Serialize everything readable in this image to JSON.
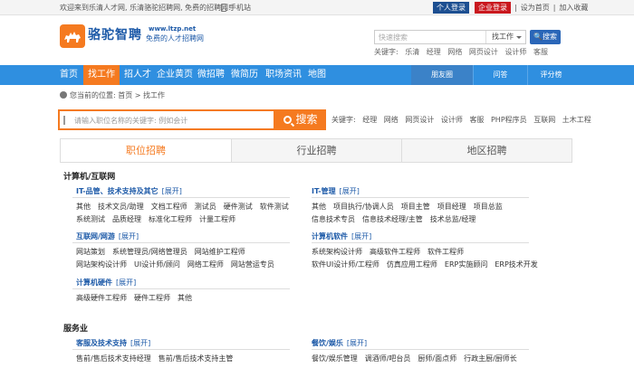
{
  "topbar": {
    "welcome": "欢迎来到乐清人才网, 乐清骆驼招聘网, 免费的招聘网!",
    "mobile": "手机站",
    "personal_login": "个人登录",
    "company_login": "企业登录",
    "set_home": "设为首页",
    "bookmark": "加入收藏"
  },
  "logo": {
    "name": "骆驼智聘",
    "url": "www.ltzp.net",
    "slogan": "免费的人才招聘网"
  },
  "top_search": {
    "placeholder": "快速搜索",
    "type": "找工作",
    "button": "搜索",
    "hot_label": "关键字:",
    "hot": [
      "乐清",
      "经理",
      "网络",
      "网页设计",
      "设计师",
      "客服"
    ]
  },
  "nav": {
    "items": [
      "首页",
      "找工作",
      "招人才",
      "企业黄页",
      "微招聘",
      "微简历",
      "职场资讯",
      "地图"
    ],
    "right": [
      "朋友圈",
      "问答",
      "评分榜"
    ]
  },
  "breadcrumb": {
    "label": "您当前的位置:",
    "home": "首页",
    "sep": ">",
    "current": "找工作"
  },
  "main_search": {
    "placeholder": "请输入职位名称的关键字: 例如会计",
    "button": "搜索",
    "kw_label": "关键字:",
    "keywords": [
      "经理",
      "网络",
      "网页设计",
      "设计师",
      "客服",
      "PHP程序员",
      "互联网",
      "土木工程"
    ]
  },
  "tabs": [
    "职位招聘",
    "行业招聘",
    "地区招聘"
  ],
  "expand": "[展开]",
  "sections": {
    "s1": "计算机/互联网",
    "s2": "服务业"
  },
  "cats": {
    "c1": {
      "title": "IT-品管、技术支持及其它",
      "rows": [
        [
          "其他",
          "技术文员/助理",
          "文档工程师",
          "测试员",
          "硬件测试",
          "软件测试"
        ],
        [
          "系统测试",
          "品质经理",
          "标准化工程师",
          "计量工程师"
        ]
      ]
    },
    "c2": {
      "title": "IT-管理",
      "rows": [
        [
          "其他",
          "项目执行/协调人员",
          "项目主管",
          "项目经理",
          "项目总监"
        ],
        [
          "信息技术专员",
          "信息技术经理/主管",
          "技术总监/经理"
        ]
      ]
    },
    "c3": {
      "title": "互联网/网游",
      "rows": [
        [
          "网站策划",
          "系统管理员/网络管理员",
          "网站维护工程师"
        ],
        [
          "网站架构设计师",
          "UI设计师/顾问",
          "网络工程师",
          "网站营运专员"
        ]
      ]
    },
    "c4": {
      "title": "计算机软件",
      "rows": [
        [
          "系统架构设计师",
          "高级软件工程师",
          "软件工程师"
        ],
        [
          "软件UI设计师/工程师",
          "仿真应用工程师",
          "ERP实施顾问",
          "ERP技术开发"
        ]
      ]
    },
    "c5": {
      "title": "计算机硬件",
      "rows": [
        [
          "高级硬件工程师",
          "硬件工程师",
          "其他"
        ]
      ]
    },
    "c6": {
      "title": "客服及技术支持",
      "rows": [
        [
          "售前/售后技术支持经理",
          "售前/售后技术支持主管"
        ]
      ]
    },
    "c7": {
      "title": "餐饮/娱乐",
      "rows": [
        [
          "餐饮/娱乐管理",
          "调酒师/吧台员",
          "厨师/面点师",
          "行政主厨/厨师长"
        ]
      ]
    }
  },
  "colors": {
    "orange": "#f57a20",
    "blue": "#2f8fe0",
    "link": "#1d5aa8"
  }
}
